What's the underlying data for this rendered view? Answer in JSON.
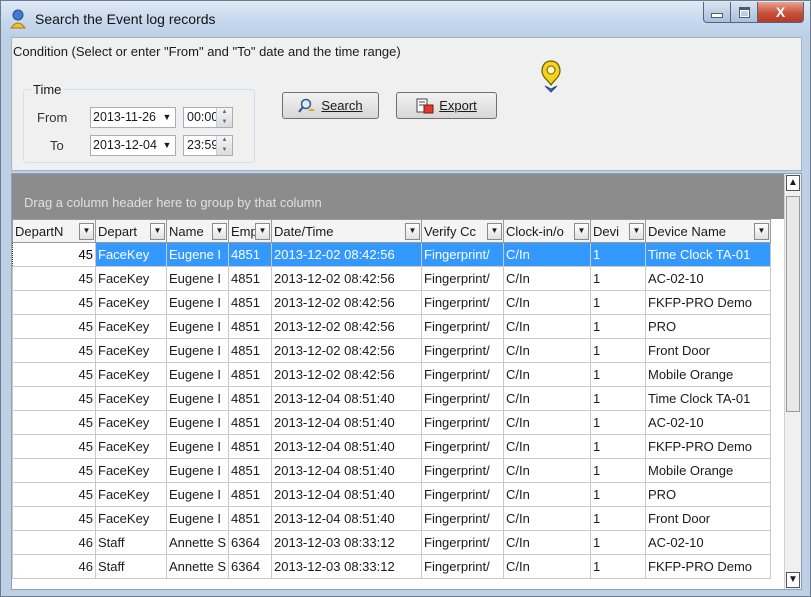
{
  "window": {
    "title": "Search the Event log records",
    "close_glyph": "X"
  },
  "condition": {
    "label": "Condition (Select or enter \"From\" and \"To\" date and the time range)",
    "time_legend": "Time",
    "from_label": "From",
    "to_label": "To",
    "from_date": "2013-11-26",
    "from_time": "00:00",
    "to_date": "2013-12-04",
    "to_time": "23:59",
    "search_button": "Search",
    "export_button": "Export"
  },
  "grid": {
    "group_hint": "Drag a column header here to group by that column",
    "columns": [
      "DepartN",
      "Depart",
      "Name",
      "Emp",
      "Date/Time",
      "Verify Cc",
      "Clock-in/o",
      "Devi",
      "Device Name"
    ],
    "rows": [
      [
        "45",
        "FaceKey",
        "Eugene I",
        "4851",
        "2013-12-02 08:42:56",
        "Fingerprint/",
        "C/In",
        "1",
        "Time Clock TA-01"
      ],
      [
        "45",
        "FaceKey",
        "Eugene I",
        "4851",
        "2013-12-02 08:42:56",
        "Fingerprint/",
        "C/In",
        "1",
        "AC-02-10"
      ],
      [
        "45",
        "FaceKey",
        "Eugene I",
        "4851",
        "2013-12-02 08:42:56",
        "Fingerprint/",
        "C/In",
        "1",
        "FKFP-PRO Demo"
      ],
      [
        "45",
        "FaceKey",
        "Eugene I",
        "4851",
        "2013-12-02 08:42:56",
        "Fingerprint/",
        "C/In",
        "1",
        "PRO"
      ],
      [
        "45",
        "FaceKey",
        "Eugene I",
        "4851",
        "2013-12-02 08:42:56",
        "Fingerprint/",
        "C/In",
        "1",
        "Front Door"
      ],
      [
        "45",
        "FaceKey",
        "Eugene I",
        "4851",
        "2013-12-02 08:42:56",
        "Fingerprint/",
        "C/In",
        "1",
        "Mobile Orange"
      ],
      [
        "45",
        "FaceKey",
        "Eugene I",
        "4851",
        "2013-12-04 08:51:40",
        "Fingerprint/",
        "C/In",
        "1",
        "Time Clock TA-01"
      ],
      [
        "45",
        "FaceKey",
        "Eugene I",
        "4851",
        "2013-12-04 08:51:40",
        "Fingerprint/",
        "C/In",
        "1",
        "AC-02-10"
      ],
      [
        "45",
        "FaceKey",
        "Eugene I",
        "4851",
        "2013-12-04 08:51:40",
        "Fingerprint/",
        "C/In",
        "1",
        "FKFP-PRO Demo"
      ],
      [
        "45",
        "FaceKey",
        "Eugene I",
        "4851",
        "2013-12-04 08:51:40",
        "Fingerprint/",
        "C/In",
        "1",
        "Mobile Orange"
      ],
      [
        "45",
        "FaceKey",
        "Eugene I",
        "4851",
        "2013-12-04 08:51:40",
        "Fingerprint/",
        "C/In",
        "1",
        "PRO"
      ],
      [
        "45",
        "FaceKey",
        "Eugene I",
        "4851",
        "2013-12-04 08:51:40",
        "Fingerprint/",
        "C/In",
        "1",
        "Front Door"
      ],
      [
        "46",
        "Staff",
        "Annette S",
        "6364",
        "2013-12-03 08:33:12",
        "Fingerprint/",
        "C/In",
        "1",
        "AC-02-10"
      ],
      [
        "46",
        "Staff",
        "Annette S",
        "6364",
        "2013-12-03 08:33:12",
        "Fingerprint/",
        "C/In",
        "1",
        "FKFP-PRO Demo"
      ]
    ],
    "selected_row": 0
  },
  "colors": {
    "selection": "#3399ff",
    "group_panel": "#8c8c8c"
  }
}
